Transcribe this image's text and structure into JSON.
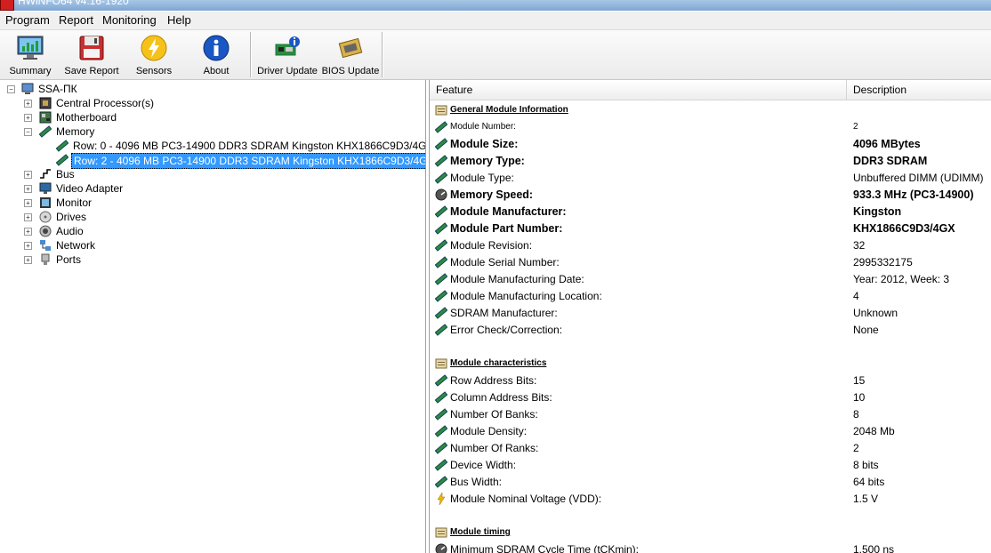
{
  "window": {
    "title": "HWiNFO64 v4.16-1920"
  },
  "menu": [
    "Program",
    "Report",
    "Monitoring",
    "Help"
  ],
  "toolbar": {
    "summary": "Summary",
    "save_report": "Save Report",
    "sensors": "Sensors",
    "about": "About",
    "driver_update": "Driver Update",
    "bios_update": "BIOS Update"
  },
  "tree": {
    "root": "SSA-ПК",
    "cpu": "Central Processor(s)",
    "motherboard": "Motherboard",
    "memory": "Memory",
    "mem_row0": "Row: 0 - 4096 MB PC3-14900 DDR3 SDRAM Kingston KHX1866C9D3/4G",
    "mem_row2": "Row: 2 - 4096 MB PC3-14900 DDR3 SDRAM Kingston KHX1866C9D3/4G",
    "bus": "Bus",
    "video": "Video Adapter",
    "monitor": "Monitor",
    "drives": "Drives",
    "audio": "Audio",
    "network": "Network",
    "ports": "Ports"
  },
  "details": {
    "header_feature": "Feature",
    "header_description": "Description",
    "rows": [
      {
        "type": "section",
        "icon": "section-icon",
        "feature": "General Module Information",
        "value": ""
      },
      {
        "type": "small",
        "icon": "ram-icon",
        "feature": "Module Number:",
        "value": "2"
      },
      {
        "type": "bold",
        "icon": "ram-icon",
        "feature": "Module Size:",
        "value": "4096 MBytes"
      },
      {
        "type": "bold",
        "icon": "ram-icon",
        "feature": "Memory Type:",
        "value": "DDR3 SDRAM"
      },
      {
        "type": "normal",
        "icon": "ram-icon",
        "feature": "Module Type:",
        "value": "Unbuffered DIMM (UDIMM)"
      },
      {
        "type": "bold",
        "icon": "gauge-icon",
        "feature": "Memory Speed:",
        "value": "933.3 MHz (PC3-14900)"
      },
      {
        "type": "bold",
        "icon": "ram-icon",
        "feature": "Module Manufacturer:",
        "value": "Kingston"
      },
      {
        "type": "bold",
        "icon": "ram-icon",
        "feature": "Module Part Number:",
        "value": "KHX1866C9D3/4GX"
      },
      {
        "type": "normal",
        "icon": "ram-icon",
        "feature": "Module Revision:",
        "value": "32"
      },
      {
        "type": "normal",
        "icon": "ram-icon",
        "feature": "Module Serial Number:",
        "value": "2995332175"
      },
      {
        "type": "normal",
        "icon": "ram-icon",
        "feature": "Module Manufacturing Date:",
        "value": "Year: 2012, Week: 3"
      },
      {
        "type": "normal",
        "icon": "ram-icon",
        "feature": "Module Manufacturing Location:",
        "value": "4"
      },
      {
        "type": "normal",
        "icon": "ram-icon",
        "feature": "SDRAM Manufacturer:",
        "value": "Unknown"
      },
      {
        "type": "normal",
        "icon": "ram-icon",
        "feature": "Error Check/Correction:",
        "value": "None"
      },
      {
        "type": "blank",
        "icon": "",
        "feature": "",
        "value": ""
      },
      {
        "type": "section",
        "icon": "section-icon",
        "feature": "Module characteristics",
        "value": ""
      },
      {
        "type": "normal",
        "icon": "ram-icon",
        "feature": "Row Address Bits:",
        "value": "15"
      },
      {
        "type": "normal",
        "icon": "ram-icon",
        "feature": "Column Address Bits:",
        "value": "10"
      },
      {
        "type": "normal",
        "icon": "ram-icon",
        "feature": "Number Of Banks:",
        "value": "8"
      },
      {
        "type": "normal",
        "icon": "ram-icon",
        "feature": "Module Density:",
        "value": "2048 Mb"
      },
      {
        "type": "normal",
        "icon": "ram-icon",
        "feature": "Number Of Ranks:",
        "value": "2"
      },
      {
        "type": "normal",
        "icon": "ram-icon",
        "feature": "Device Width:",
        "value": "8 bits"
      },
      {
        "type": "normal",
        "icon": "ram-icon",
        "feature": "Bus Width:",
        "value": "64 bits"
      },
      {
        "type": "normal",
        "icon": "lightning-icon",
        "feature": "Module Nominal Voltage (VDD):",
        "value": "1.5 V"
      },
      {
        "type": "blank",
        "icon": "",
        "feature": "",
        "value": ""
      },
      {
        "type": "section",
        "icon": "section-icon",
        "feature": "Module timing",
        "value": ""
      },
      {
        "type": "normal",
        "icon": "gauge-icon",
        "feature": "Minimum SDRAM Cycle Time (tCKmin):",
        "value": "1.500 ns"
      }
    ]
  }
}
